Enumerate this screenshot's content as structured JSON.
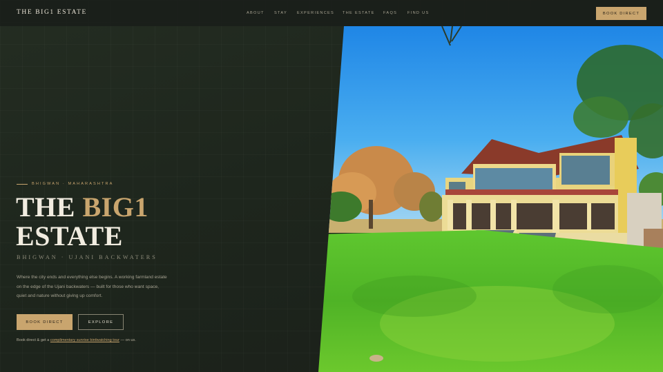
{
  "nav": {
    "logo": "THE BIG1 ESTATE",
    "links": [
      "ABOUT",
      "STAY",
      "EXPERIENCES",
      "THE ESTATE",
      "FAQS",
      "FIND US"
    ],
    "cta": "BOOK DIRECT"
  },
  "hero": {
    "eyebrow": "BHIGWAN · MAHARASHTRA",
    "title_line1_plain": "THE ",
    "title_line1_accent": "BIG1",
    "title_line2": "ESTATE",
    "subtitle": "BHIGWAN · UJANI BACKWATERS",
    "description": "Where the city ends and everything else begins. A working farmland estate on the edge of the Ujani backwaters — built for those who want space, quiet and nature without giving up comfort.",
    "primary_button": "BOOK DIRECT",
    "secondary_button": "EXPLORE",
    "offer_prefix": "Book direct & get a ",
    "offer_link": "complimentary sunrise birdwatching tour",
    "offer_suffix": " — on us."
  },
  "colors": {
    "accent": "#c9a56e",
    "background": "#1c2119",
    "text": "#f1ece0"
  }
}
